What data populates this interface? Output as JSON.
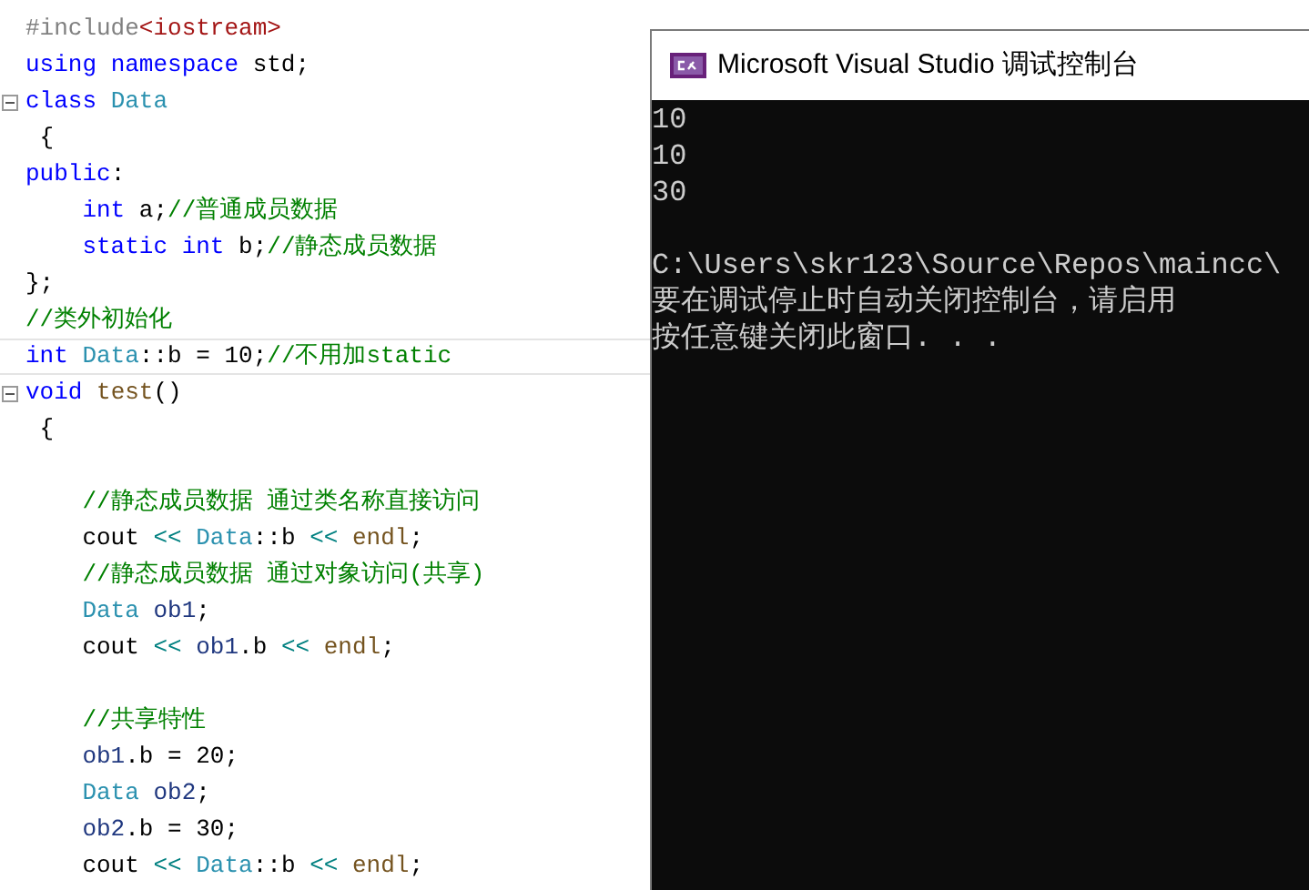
{
  "editor": {
    "lines": [
      {
        "tokens": [
          {
            "kind": "preproc",
            "text": "#include"
          },
          {
            "kind": "string",
            "text": "<iostream>"
          }
        ]
      },
      {
        "tokens": [
          {
            "kind": "keyword",
            "text": "using"
          },
          {
            "kind": "keyword",
            "text": " namespace"
          },
          {
            "kind": "plain",
            "text": " std;"
          }
        ]
      },
      {
        "fold": true,
        "tokens": [
          {
            "kind": "keyword",
            "text": "class"
          },
          {
            "kind": "type",
            "text": " Data"
          }
        ]
      },
      {
        "tokens": [
          {
            "kind": "plain",
            "text": " {"
          }
        ]
      },
      {
        "tokens": [
          {
            "kind": "keyword",
            "text": "public"
          },
          {
            "kind": "plain",
            "text": ":"
          }
        ]
      },
      {
        "tokens": [
          {
            "kind": "keyword",
            "text": "    int"
          },
          {
            "kind": "plain",
            "text": " a;"
          },
          {
            "kind": "comment",
            "text": "//普通成员数据"
          }
        ]
      },
      {
        "tokens": [
          {
            "kind": "keyword",
            "text": "    static"
          },
          {
            "kind": "keyword",
            "text": " int"
          },
          {
            "kind": "plain",
            "text": " b;"
          },
          {
            "kind": "comment",
            "text": "//静态成员数据"
          }
        ]
      },
      {
        "tokens": [
          {
            "kind": "plain",
            "text": "};"
          }
        ]
      },
      {
        "tokens": [
          {
            "kind": "comment",
            "text": "//类外初始化"
          }
        ]
      },
      {
        "current": true,
        "tokens": [
          {
            "kind": "keyword",
            "text": "int"
          },
          {
            "kind": "type",
            "text": " Data"
          },
          {
            "kind": "plain",
            "text": "::b = 10;"
          },
          {
            "kind": "comment",
            "text": "//不用加static"
          }
        ]
      },
      {
        "fold": true,
        "tokens": [
          {
            "kind": "keyword",
            "text": "void"
          },
          {
            "kind": "func",
            "text": " test"
          },
          {
            "kind": "plain",
            "text": "()"
          }
        ]
      },
      {
        "tokens": [
          {
            "kind": "plain",
            "text": " {"
          }
        ]
      },
      {
        "kind": "blank"
      },
      {
        "tokens": [
          {
            "kind": "comment",
            "text": "    //静态成员数据 通过类名称直接访问"
          }
        ]
      },
      {
        "tokens": [
          {
            "kind": "plain",
            "text": "    cout "
          },
          {
            "kind": "operator",
            "text": "<<"
          },
          {
            "kind": "type",
            "text": " Data"
          },
          {
            "kind": "plain",
            "text": "::b "
          },
          {
            "kind": "operator",
            "text": "<<"
          },
          {
            "kind": "func",
            "text": " endl"
          },
          {
            "kind": "plain",
            "text": ";"
          }
        ]
      },
      {
        "tokens": [
          {
            "kind": "comment",
            "text": "    //静态成员数据 通过对象访问(共享)"
          }
        ]
      },
      {
        "tokens": [
          {
            "kind": "type",
            "text": "    Data"
          },
          {
            "kind": "var",
            "text": " ob1"
          },
          {
            "kind": "plain",
            "text": ";"
          }
        ]
      },
      {
        "tokens": [
          {
            "kind": "plain",
            "text": "    cout "
          },
          {
            "kind": "operator",
            "text": "<<"
          },
          {
            "kind": "var",
            "text": " ob1"
          },
          {
            "kind": "plain",
            "text": ".b "
          },
          {
            "kind": "operator",
            "text": "<<"
          },
          {
            "kind": "func",
            "text": " endl"
          },
          {
            "kind": "plain",
            "text": ";"
          }
        ]
      },
      {
        "kind": "blank"
      },
      {
        "tokens": [
          {
            "kind": "comment",
            "text": "    //共享特性"
          }
        ]
      },
      {
        "tokens": [
          {
            "kind": "var",
            "text": "    ob1"
          },
          {
            "kind": "plain",
            "text": ".b = 20;"
          }
        ]
      },
      {
        "tokens": [
          {
            "kind": "type",
            "text": "    Data"
          },
          {
            "kind": "var",
            "text": " ob2"
          },
          {
            "kind": "plain",
            "text": ";"
          }
        ]
      },
      {
        "tokens": [
          {
            "kind": "var",
            "text": "    ob2"
          },
          {
            "kind": "plain",
            "text": ".b = 30;"
          }
        ]
      },
      {
        "tokens": [
          {
            "kind": "plain",
            "text": "    cout "
          },
          {
            "kind": "operator",
            "text": "<<"
          },
          {
            "kind": "type",
            "text": " Data"
          },
          {
            "kind": "plain",
            "text": "::b "
          },
          {
            "kind": "operator",
            "text": "<<"
          },
          {
            "kind": "func",
            "text": " endl"
          },
          {
            "kind": "plain",
            "text": ";"
          }
        ]
      }
    ]
  },
  "console": {
    "title": "Microsoft Visual Studio 调试控制台",
    "output": [
      "10",
      "10",
      "30"
    ],
    "messages": [
      "C:\\Users\\skr123\\Source\\Repos\\maincc\\",
      "要在调试停止时自动关闭控制台，请启用",
      "按任意键关闭此窗口. . ."
    ]
  }
}
